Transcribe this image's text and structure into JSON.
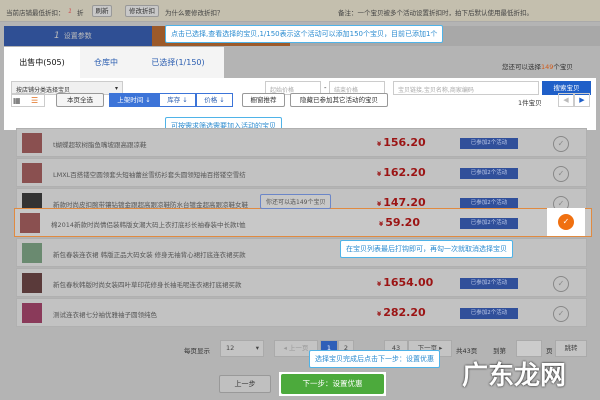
{
  "topbar": {
    "min_discount_label": "当前店铺最低折扣：",
    "min_discount_value": "1",
    "discount_unit": "折",
    "refresh": "刷新",
    "modify": "修改折扣",
    "why": "为什么要修改折扣？",
    "note": "备注：一个宝贝被多个活动设置折扣时，拍下后默认使用最低折扣。"
  },
  "steps": {
    "step1_num": "1",
    "step1_label": "设置参数"
  },
  "tips": {
    "tip1": "点击已选择,查看选择的宝贝,1/150表示这个活动可以添加150个宝贝，目前已添加1个",
    "tip2": "可按需求筛选需要加入活动的宝贝",
    "tip3": "你还可以选149个宝贝",
    "tip4": "在宝贝列表最后打钩即可，再勾一次就取消选择宝贝",
    "tip5": "选择宝贝完成后点击下一步：设置优惠"
  },
  "tabs": [
    {
      "label": "出售中(505)"
    },
    {
      "label": "仓库中"
    },
    {
      "label": "已选择(1/150)"
    }
  ],
  "remaining": {
    "prefix": "您还可以选择",
    "count": "149",
    "suffix": "个宝贝"
  },
  "filter": {
    "category": "按店铺分类选择宝贝",
    "price_start": "起始价格",
    "price_end": "结束价格",
    "search_placeholder": "宝贝链接,宝贝名称,商家编码",
    "search_btn": "搜索宝贝",
    "select_all": "本页全选",
    "sort_time": "上架时间",
    "sort_stock": "库存",
    "sort_price": "价格",
    "recommend": "橱窗推荐",
    "hide_other": "隐藏已参加其它活动的宝贝",
    "count": "1件宝贝"
  },
  "items": [
    {
      "title": "t蝴蝶超软树脂鱼嘴坡跟高跟凉鞋",
      "price": "156.20",
      "badge": "已参加2个活动"
    },
    {
      "title": "LMXL百搭镂空圆领套头短袖蕾丝雪纺衫套头圆领短袖百搭镂空雪纺",
      "price": "162.20",
      "badge": "已参加2个活动"
    },
    {
      "title": "新款时尚皮扣腕带镶钻镀金跟超高跟凉鞋防水台镀金超高跟凉鞋女鞋",
      "price": "147.20",
      "badge": "已参加2个活动"
    },
    {
      "title": "棉2014新款时尚情侣装韩版女潮大码上衣打底衫长袖春装中长款t恤",
      "price": "59.20",
      "badge": "已参加2个活动"
    },
    {
      "title": "新包春装连衣裙 韩版正品大码女装 修身无袖背心裙打底连衣裙买款",
      "price": "",
      "badge": ""
    },
    {
      "title": "新包春秋韩版时尚女装四叶草印花修身长袖毛呢连衣裙打底裙买款",
      "price": "1654.00",
      "badge": "已参加2个活动"
    },
    {
      "title": "测试连衣裙七分袖优雅袖子圆领纯色",
      "price": "282.20",
      "badge": "已参加2个活动"
    }
  ],
  "currency": "¥",
  "pagination": {
    "per_page_label": "每页显示",
    "per_page": "12",
    "prev": "◂ 上一页",
    "p1": "1",
    "p2": "2",
    "p43": "43",
    "next": "下一页 ▸",
    "total": "共43页",
    "goto": "到第",
    "page_unit": "页",
    "jump": "跳转"
  },
  "footer": {
    "prev_step": "上一步",
    "next_step": "下一步：设置优惠"
  },
  "watermark": "广东龙网"
}
